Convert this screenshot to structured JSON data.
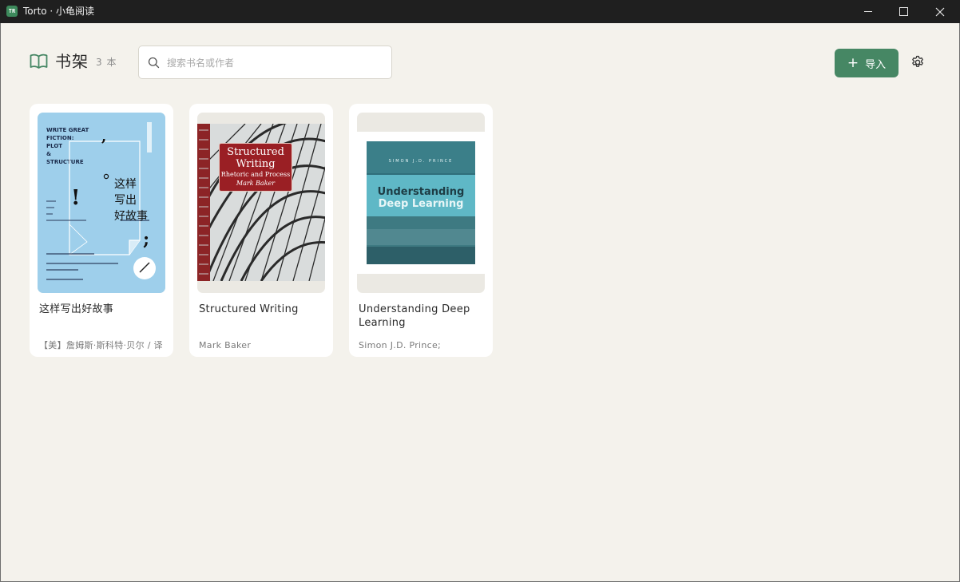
{
  "window": {
    "title": "Torto · 小龟阅读",
    "logo_text": "TR"
  },
  "header": {
    "title": "书架",
    "count": "3 本",
    "search_placeholder": "搜索书名或作者",
    "import_label": "导入",
    "import_plus": "+"
  },
  "books": [
    {
      "title": "这样写出好故事",
      "author": "【美】詹姆斯·斯科特·贝尔 / 译",
      "cover": {
        "en_lines": [
          "WRITE GREAT",
          "FICTION:",
          "PLOT",
          "&",
          "STRUCTURE"
        ],
        "cn_lines": [
          "这样",
          "写出",
          "好故事"
        ],
        "bg": "#9ecfeb"
      }
    },
    {
      "title": "Structured Writing",
      "author": "Mark Baker",
      "cover": {
        "line1": "Structured",
        "line2": "Writing",
        "line3": "Rhetoric and Process",
        "line4": "Mark Baker",
        "bg": "#9a1f24"
      }
    },
    {
      "title": "Understanding Deep Learning",
      "author": "Simon J.D. Prince;",
      "cover": {
        "author_line": "SIMON J.D. PRINCE",
        "line1": "Understanding",
        "line2": "Deep Learning",
        "bg": "#2f6f7a"
      }
    }
  ],
  "colors": {
    "accent": "#468764",
    "background": "#f4f2ec",
    "titlebar": "#1f1f1f"
  }
}
